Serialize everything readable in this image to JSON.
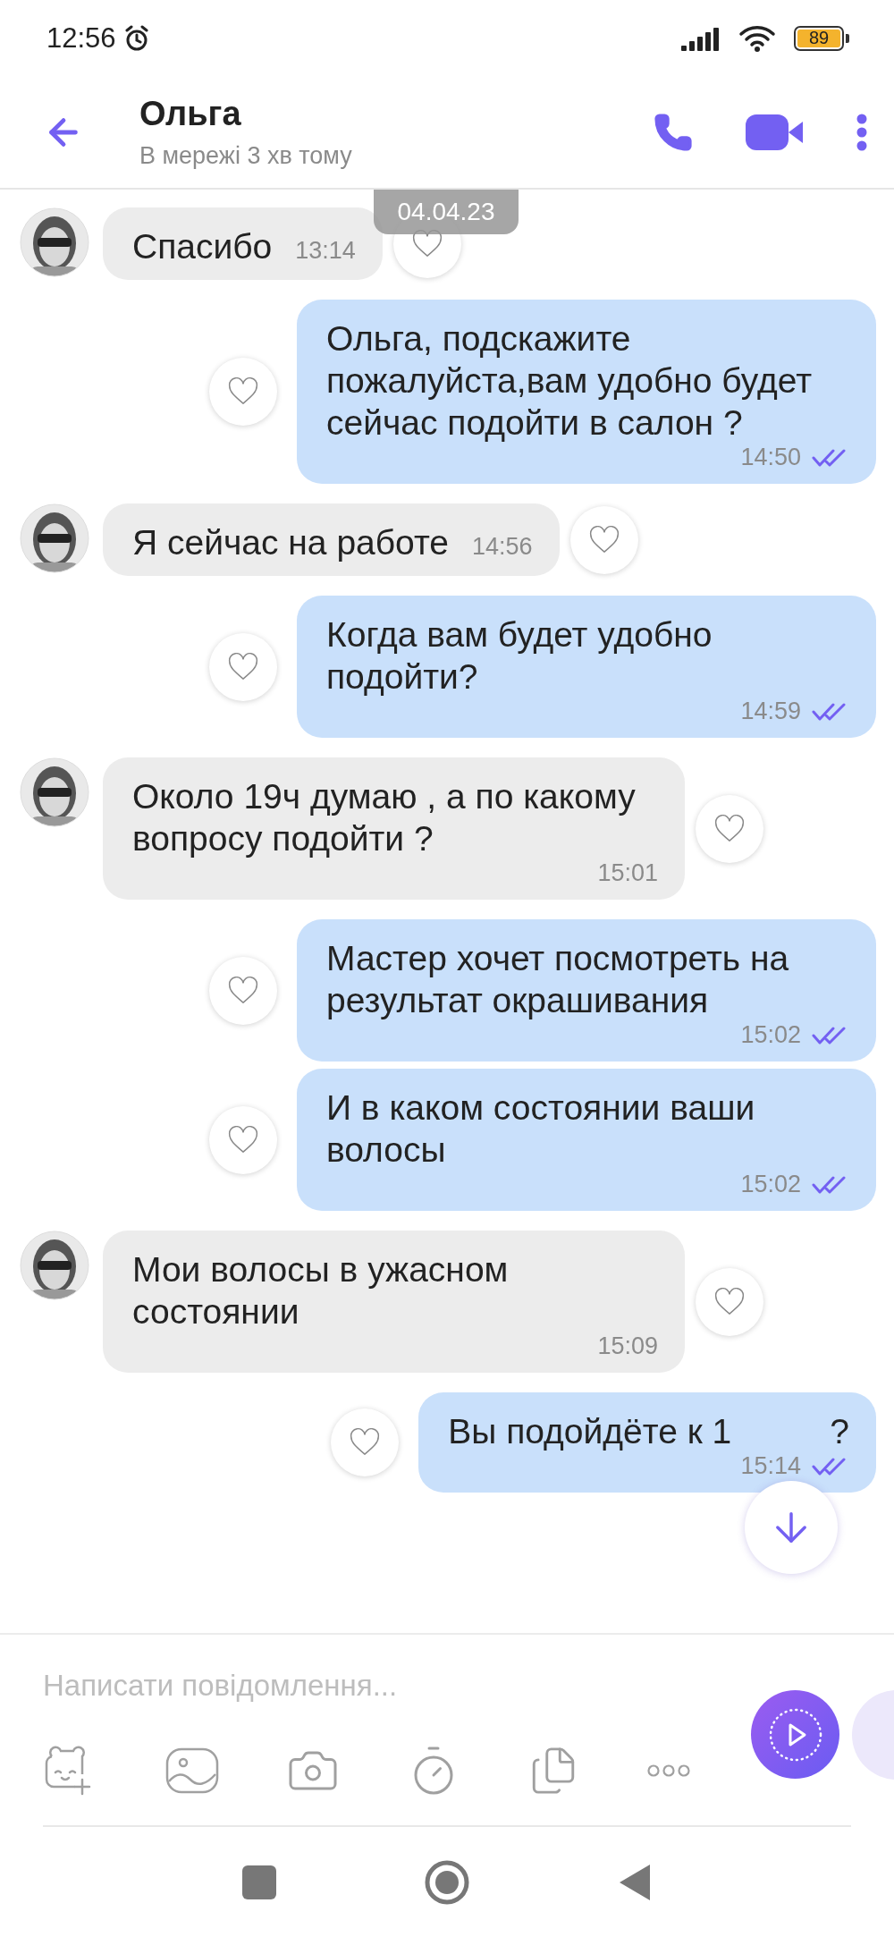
{
  "status_bar": {
    "time": "12:56",
    "battery": "89"
  },
  "header": {
    "title": "Ольга",
    "subtitle": "В мережі 3 хв тому"
  },
  "date_badge": "04.04.23",
  "messages": [
    {
      "outgoing": false,
      "text": "Спасибо",
      "time": "13:14"
    },
    {
      "outgoing": true,
      "text": "Ольга, подскажите пожалуйста,вам удобно будет сейчас подойти в салон ?",
      "time": "14:50",
      "read": true
    },
    {
      "outgoing": false,
      "text": "Я сейчас на работе",
      "time": "14:56"
    },
    {
      "outgoing": true,
      "text": "Когда вам будет удобно подойти?",
      "time": "14:59",
      "read": true
    },
    {
      "outgoing": false,
      "text": "Около 19ч думаю , а по какому вопросу подойти ?",
      "time": "15:01"
    },
    {
      "outgoing": true,
      "text": "Мастер хочет посмотреть на результат окрашивания",
      "time": "15:02",
      "read": true
    },
    {
      "outgoing": true,
      "text": "И в каком состоянии ваши волосы",
      "time": "15:02",
      "read": true
    },
    {
      "outgoing": false,
      "text": "Мои волосы в ужасном состоянии",
      "time": "15:09"
    },
    {
      "outgoing": true,
      "text": "Вы подойдёте к 1",
      "text_after_cover": "?",
      "time": "15:14",
      "read": true
    }
  ],
  "composer": {
    "placeholder": "Написати повідомлення..."
  }
}
